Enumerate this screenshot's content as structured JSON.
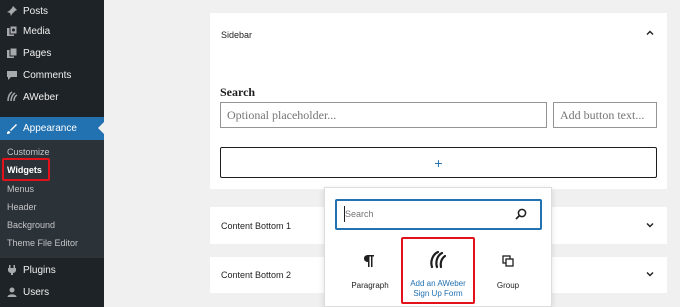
{
  "sidebar": {
    "menu": [
      {
        "label": "Posts",
        "icon": "pin-icon"
      },
      {
        "label": "Media",
        "icon": "media-icon"
      },
      {
        "label": "Pages",
        "icon": "pages-icon"
      },
      {
        "label": "Comments",
        "icon": "comments-icon"
      },
      {
        "label": "AWeber",
        "icon": "aweber-icon"
      },
      {
        "label": "Appearance",
        "icon": "appearance-icon"
      },
      {
        "label": "Plugins",
        "icon": "plugins-icon"
      },
      {
        "label": "Users",
        "icon": "users-icon"
      }
    ],
    "submenu": [
      {
        "label": "Customize"
      },
      {
        "label": "Widgets"
      },
      {
        "label": "Menus"
      },
      {
        "label": "Header"
      },
      {
        "label": "Background"
      },
      {
        "label": "Theme File Editor"
      }
    ]
  },
  "panels": {
    "sidebar_title": "Sidebar",
    "content_bottom_1": "Content Bottom 1",
    "content_bottom_2": "Content Bottom 2"
  },
  "search_widget": {
    "label": "Search",
    "input_placeholder": "Optional placeholder...",
    "button_placeholder": "Add button text..."
  },
  "add_block": {
    "symbol": "+"
  },
  "inserter": {
    "search_placeholder": "Search",
    "blocks": [
      {
        "label": "Paragraph",
        "icon": "paragraph-icon"
      },
      {
        "label_line1": "Add an AWeber",
        "label_line2": "Sign Up Form",
        "icon": "aweber-icon"
      },
      {
        "label": "Group",
        "icon": "group-icon"
      }
    ]
  },
  "colors": {
    "admin_sidebar": "#1d2327",
    "submenu_bg": "#2c3338",
    "accent": "#2271b1",
    "highlight": "#e3111a"
  }
}
